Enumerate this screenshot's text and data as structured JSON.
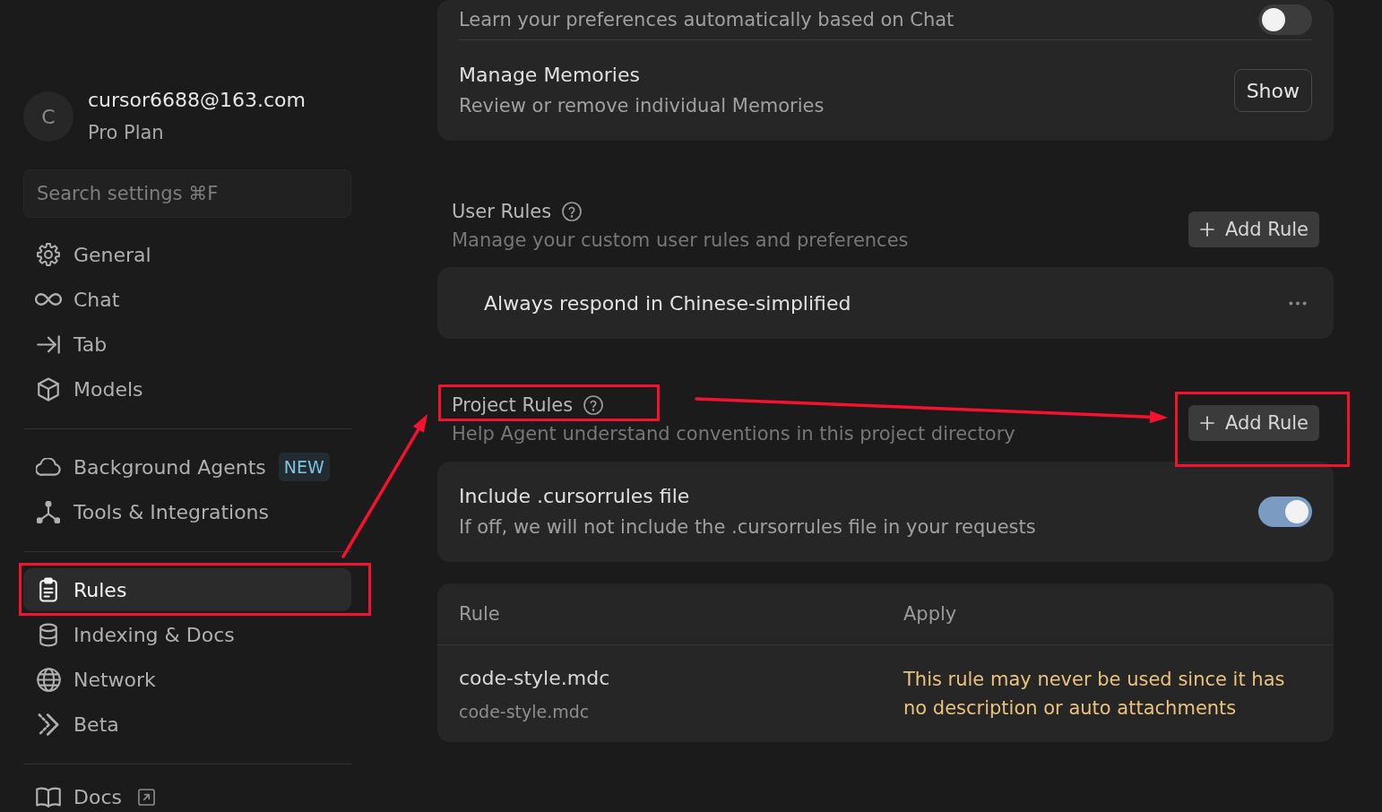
{
  "sidebar": {
    "account": {
      "avatar": "C",
      "email": "cursor6688@163.com",
      "plan": "Pro Plan"
    },
    "search": {
      "placeholder": "Search settings ⌘F"
    },
    "groups": [
      {
        "items": [
          {
            "label": "General",
            "selected": false,
            "outlined": false,
            "arrow": false,
            "external": false
          },
          {
            "label": "Chat",
            "selected": false,
            "outlined": false,
            "arrow": false,
            "external": false
          },
          {
            "label": "Tab",
            "selected": false,
            "outlined": false,
            "arrow": false,
            "external": false
          },
          {
            "label": "Models",
            "selected": false,
            "outlined": false,
            "arrow": false,
            "external": false
          }
        ]
      },
      {
        "items": [
          {
            "label": "Background Agents",
            "badge": "NEW",
            "selected": false,
            "outlined": false,
            "arrow": false,
            "external": false
          },
          {
            "label": "Tools & Integrations",
            "selected": false,
            "outlined": false,
            "arrow": false,
            "external": false
          }
        ]
      },
      {
        "items": [
          {
            "label": "Rules",
            "selected": true,
            "outlined": true,
            "arrow": true,
            "external": false
          },
          {
            "label": "Indexing & Docs",
            "selected": false,
            "outlined": false,
            "arrow": false,
            "external": false
          },
          {
            "label": "Network",
            "selected": false,
            "outlined": false,
            "arrow": false,
            "external": false
          },
          {
            "label": "Beta",
            "selected": false,
            "outlined": false,
            "arrow": false,
            "external": false
          }
        ]
      },
      {
        "items": [
          {
            "label": "Docs",
            "selected": false,
            "outlined": false,
            "arrow": false,
            "external": true
          }
        ]
      }
    ]
  },
  "memories_card": {
    "rows": [
      {
        "kind": "toggle",
        "description": "Learn your preferences automatically based on Chat",
        "on": false
      },
      {
        "kind": "button",
        "title": "Manage Memories",
        "description": "Review or remove individual Memories",
        "button": "Show"
      }
    ]
  },
  "user_rules": {
    "title": "User Rules",
    "outlined": false,
    "arrow": false,
    "description": "Manage your custom user rules and preferences",
    "add_button": {
      "label": "Add Rule",
      "outlined": false
    },
    "rules": [
      {
        "text": "Always respond in Chinese-simplified"
      }
    ]
  },
  "project_rules": {
    "title": "Project Rules",
    "outlined": true,
    "arrow": true,
    "description": "Help Agent understand conventions in this project directory",
    "add_button": {
      "label": "Add Rule",
      "outlined": true
    },
    "settings": [
      {
        "kind": "toggle",
        "title": "Include .cursorrules file",
        "description": "If off, we will not include the .cursorrules file in your requests",
        "on": true
      }
    ],
    "table": {
      "columns": [
        "Rule",
        "Apply"
      ],
      "rows": [
        {
          "name": "code-style.mdc",
          "path": "code-style.mdc",
          "apply": "This rule may never be used since it has no description or auto attachments",
          "warning": true
        }
      ]
    }
  }
}
